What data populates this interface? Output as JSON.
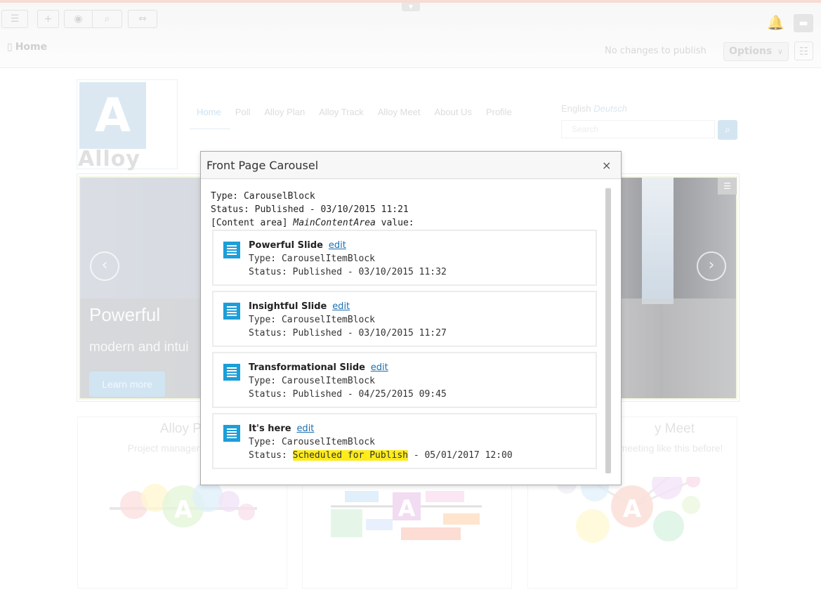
{
  "toolbar": {
    "breadcrumb": "Home",
    "publish_status": "No changes to publish",
    "options_label": "Options"
  },
  "site": {
    "logo_letter": "A",
    "logo_text": "Alloy",
    "nav": [
      "Home",
      "Poll",
      "Alloy Plan",
      "Alloy Track",
      "Alloy Meet",
      "About Us",
      "Profile"
    ],
    "lang_current": "English",
    "lang_other": "Deutsch",
    "search_placeholder": "Search",
    "carousel": {
      "title": "Powerful",
      "subtitle": "modern and intui",
      "button": "Learn more"
    },
    "teasers": [
      {
        "title": "Alloy Pl",
        "text": "Project management has"
      },
      {
        "title": "",
        "text": ""
      },
      {
        "title": "y Meet",
        "text": "meeting like this before!"
      }
    ]
  },
  "dialog": {
    "title": "Front Page Carousel",
    "close_icon": "×",
    "type_line": "Type: CarouselBlock",
    "status_line": "Status: Published - 03/10/2015 11:21",
    "area_prefix": "[Content area] ",
    "area_name": "MainContentArea",
    "area_suffix": " value:",
    "edit_label": "edit",
    "items": [
      {
        "name": "Powerful Slide",
        "type": "Type: CarouselItemBlock",
        "status_prefix": "Status: ",
        "status": "Published",
        "status_date": " - 03/10/2015 11:32"
      },
      {
        "name": "Insightful Slide",
        "type": "Type: CarouselItemBlock",
        "status_prefix": "Status: ",
        "status": "Published",
        "status_date": " - 03/10/2015 11:27"
      },
      {
        "name": "Transformational Slide",
        "type": "Type: CarouselItemBlock",
        "status_prefix": "Status: ",
        "status": "Published",
        "status_date": " - 04/25/2015 09:45"
      },
      {
        "name": "It's here",
        "type": "Type: CarouselItemBlock",
        "status_prefix": "Status: ",
        "status": "Scheduled for Publish",
        "status_date": " - 05/01/2017 12:00"
      }
    ]
  },
  "colors": {
    "accent": "#1c9ed8",
    "link": "#1a6fb3",
    "highlight": "#ffec1a"
  }
}
